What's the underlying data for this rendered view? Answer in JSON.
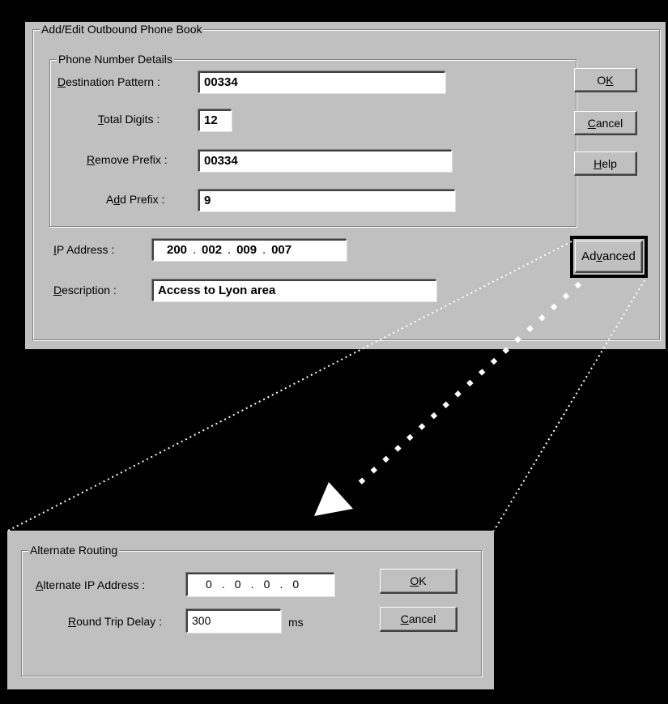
{
  "main_dialog": {
    "group_title": "Add/Edit Outbound Phone Book",
    "details_group_title": "Phone Number Details",
    "destination_pattern": {
      "label_mnemonic": "D",
      "label_rest": "estination Pattern :",
      "value": "00334"
    },
    "total_digits": {
      "label_mnemonic": "T",
      "label_rest": "otal Digits :",
      "value": "12"
    },
    "remove_prefix": {
      "label_mnemonic": "R",
      "label_rest": "emove Prefix :",
      "value": "00334"
    },
    "add_prefix": {
      "label_pre": "A",
      "label_mnemonic": "d",
      "label_rest": "d Prefix :",
      "value": "9"
    },
    "ip_address": {
      "label_mnemonic": "I",
      "label_rest": "P Address :",
      "octets": [
        "200",
        "002",
        "009",
        "007"
      ],
      "separator": "."
    },
    "description": {
      "label_mnemonic": "D",
      "label_rest": "escription :",
      "value": "Access to Lyon area"
    },
    "ok_button": {
      "pre": "O",
      "mnemonic": "K",
      "post": ""
    },
    "cancel_button": {
      "pre": "",
      "mnemonic": "C",
      "post": "ancel"
    },
    "help_button": {
      "pre": "",
      "mnemonic": "H",
      "post": "elp"
    },
    "advanced_button": {
      "pre": "Ad",
      "mnemonic": "v",
      "post": "anced"
    }
  },
  "alternate_dialog": {
    "group_title": "Alternate Routing",
    "alt_ip": {
      "label_mnemonic": "A",
      "label_rest": "lternate IP Address :",
      "octets": [
        "0",
        "0",
        "0",
        "0"
      ],
      "separator": "."
    },
    "round_trip": {
      "label_mnemonic": "R",
      "label_rest": "ound Trip Delay :",
      "value": "300",
      "unit": "ms"
    },
    "ok_button": {
      "pre": "",
      "mnemonic": "O",
      "post": "K"
    },
    "cancel_button": {
      "pre": "",
      "mnemonic": "C",
      "post": "ancel"
    }
  },
  "colors": {
    "dialog": "#c0c0c0",
    "background": "#000000",
    "callout": "#ffffff"
  }
}
